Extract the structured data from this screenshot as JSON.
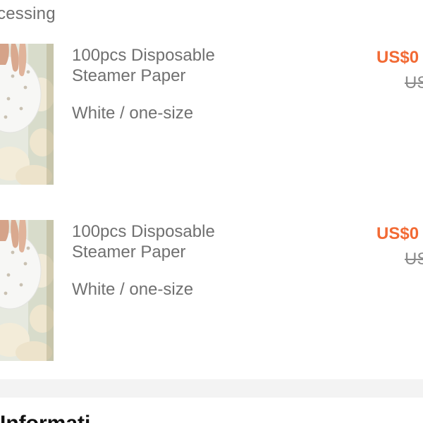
{
  "header": {
    "status_text": "cessing"
  },
  "order_items": [
    {
      "title": "100pcs Disposable\nSteamer Paper",
      "variant": "White / one-size",
      "price_current": "US$0",
      "price_original": "US"
    },
    {
      "title": "100pcs Disposable\nSteamer Paper",
      "variant": "White / one-size",
      "price_current": "US$0",
      "price_original": "US"
    }
  ],
  "info_section": {
    "heading": "Informati"
  },
  "colors": {
    "price_accent": "#f26a34",
    "text_muted": "#707070",
    "divider": "#f3f3f3"
  }
}
